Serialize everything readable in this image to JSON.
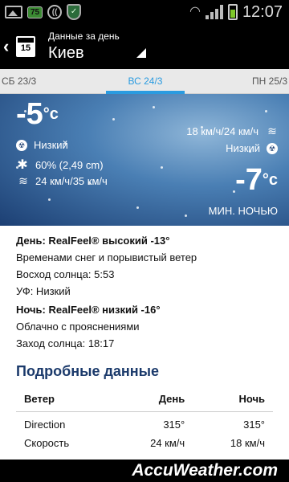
{
  "statusbar": {
    "badge": "75",
    "time": "12:07"
  },
  "header": {
    "calendar_day": "15",
    "subtitle": "Данные за день",
    "city": "Киев"
  },
  "tabs": {
    "prev": "СБ 23/3",
    "current": "ВС 24/3",
    "next": "ПН 25/3"
  },
  "hero": {
    "temp": "-5",
    "deg": "°c",
    "uv": "Низкий",
    "precip": "60% (2,49 cm)",
    "wind": "24 км/ч/35 км/ч",
    "night_wind": "18 км/ч/24 км/ч",
    "night_uv": "Низкий",
    "night_temp": "-7",
    "night_deg": "°c",
    "night_label": "МИН. НОЧЬЮ"
  },
  "details": {
    "day_realfeel": "День: RealFeel® высокий -13°",
    "day_desc": "Временами снег и порывистый ветер",
    "sunrise": "Восход солнца: 5:53",
    "uv": "УФ: Низкий",
    "night_realfeel": "Ночь: RealFeel® низкий -16°",
    "night_desc": "Облачно с прояснениями",
    "sunset": "Заход солнца: 18:17"
  },
  "section": {
    "title": "Подробные данные"
  },
  "table": {
    "headers": [
      "Ветер",
      "День",
      "Ночь"
    ],
    "rows": [
      [
        "Direction",
        "315°",
        "315°"
      ],
      [
        "Скорость",
        "24 км/ч",
        "18 км/ч"
      ]
    ]
  },
  "footer": {
    "brand": "AccuWeather.com"
  }
}
